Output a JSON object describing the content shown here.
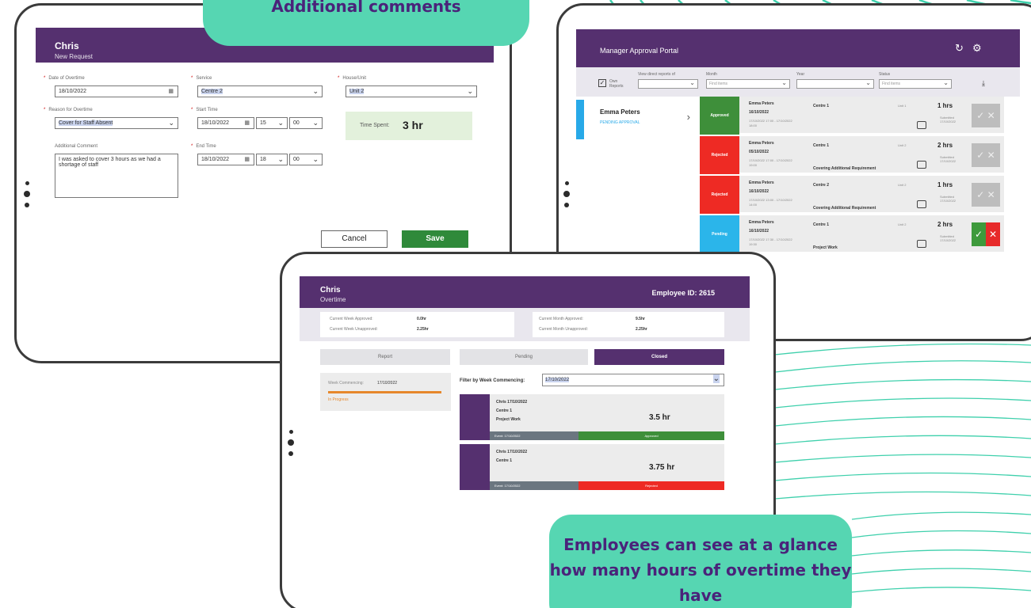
{
  "callouts": {
    "top": "Additional comments",
    "bottom": "Employees can see at a glance how many hours of overtime they have"
  },
  "new_request": {
    "name": "Chris",
    "subtitle": "New Request",
    "fields": {
      "date_label": "Date of Overtime",
      "date_value": "18/10/2022",
      "service_label": "Service",
      "service_value": "Centre 2",
      "house_label": "House/Unit",
      "house_value": "Unit 2",
      "reason_label": "Reason for Overtime",
      "reason_value": "Cover for Staff Absent",
      "start_label": "Start Time",
      "start_date": "18/10/2022",
      "start_hour": "15",
      "start_min": "00",
      "end_label": "End Time",
      "end_date": "18/10/2022",
      "end_hour": "18",
      "end_min": "00",
      "comment_label": "Additional Comment",
      "comment_value": "I was asked to cover 3 hours as we had a shortage of staff"
    },
    "time_spent_label": "Time Spent:",
    "time_spent_value": "3 hr",
    "cancel": "Cancel",
    "save": "Save"
  },
  "manager": {
    "title": "Manager Approval Portal",
    "filters": {
      "own_reports": "Own Reports",
      "direct_label": "View direct reports of",
      "month_label": "Month",
      "month_placeholder": "Find items",
      "year_label": "Year",
      "status_label": "Status",
      "status_placeholder": "Find items"
    },
    "employee": {
      "name": "Emma Peters",
      "status": "PENDING APPROVAL"
    },
    "requests": [
      {
        "status": "Approved",
        "color": "#3e8f3a",
        "name": "Emma Peters",
        "date": "16/10/2022",
        "times": "17/10/2022 17:00 - 17/10/2022 18:00",
        "centre": "Centre 1",
        "unit": "Unit 1",
        "reason": "",
        "hours": "1 hrs",
        "submitted": "Submitted 17/10/2022",
        "active": false
      },
      {
        "status": "Rejected",
        "color": "#ee2a24",
        "name": "Emma Peters",
        "date": "05/10/2022",
        "times": "17/10/2022 17:00 - 17/10/2022 19:00",
        "centre": "Centre 1",
        "unit": "Unit 2",
        "reason": "Covering Additional Requirement",
        "hours": "2 hrs",
        "submitted": "Submitted 17/10/2022",
        "active": false
      },
      {
        "status": "Rejected",
        "color": "#ee2a24",
        "name": "Emma Peters",
        "date": "16/10/2022",
        "times": "17/10/2022 13:00 - 17/10/2022 14:00",
        "centre": "Centre 2",
        "unit": "Unit 2",
        "reason": "Covering Additional Requirement",
        "hours": "1 hrs",
        "submitted": "Submitted 17/10/2022",
        "active": false
      },
      {
        "status": "Pending",
        "color": "#2bb5ea",
        "name": "Emma Peters",
        "date": "16/10/2022",
        "times": "17/10/2022 17:30 - 17/10/2022 19:30",
        "centre": "Centre 1",
        "unit": "Unit 2",
        "reason": "Project Work",
        "hours": "2 hrs",
        "submitted": "Submitted 17/10/2022",
        "active": true
      }
    ]
  },
  "employee_view": {
    "name": "Chris",
    "subtitle": "Overtime",
    "employee_id_label": "Employee ID:",
    "employee_id": "2615",
    "summary": {
      "week_approved_label": "Current Week Approved:",
      "week_approved": "0.0hr",
      "week_unapproved_label": "Current Week Unapproved:",
      "week_unapproved": "2.25hr",
      "month_approved_label": "Current Month Approved:",
      "month_approved": "9.5hr",
      "month_unapproved_label": "Current Month Unapproved:",
      "month_unapproved": "2.25hr"
    },
    "tabs": [
      "Report",
      "Pending",
      "Closed"
    ],
    "week_card": {
      "label": "Week Commencing:",
      "value": "17/10/2022",
      "status": "In Progress"
    },
    "filter_label": "Filter by Week Commencing:",
    "filter_value": "17/10/2022",
    "entries": [
      {
        "line1": "Chris 17/10/2022",
        "line2": "Centre 1",
        "line3": "Project Work",
        "hours": "3.5 hr",
        "event": "Event: 17/10/2022",
        "status": "Approved",
        "color": "#3e8f3a"
      },
      {
        "line1": "Chris 17/10/2022",
        "line2": "Centre 1",
        "line3": "",
        "hours": "3.75 hr",
        "event": "Event: 17/10/2022",
        "status": "Rejected",
        "color": "#ee2a24"
      }
    ]
  },
  "colors": {
    "brand_purple": "#55306f",
    "callout_teal": "#56d6b2",
    "wave": "#3fd0ac"
  }
}
